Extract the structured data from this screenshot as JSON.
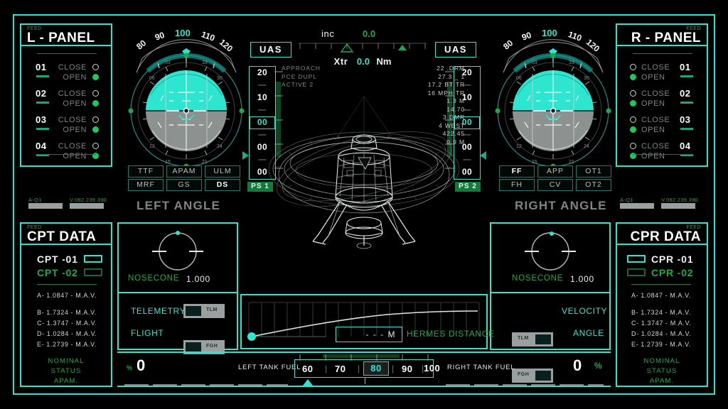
{
  "left_panel": {
    "feed": "FEED",
    "title": "L - PANEL",
    "ports": [
      {
        "num": "01",
        "close": "CLOSE",
        "open": "OPEN"
      },
      {
        "num": "02",
        "close": "CLOSE",
        "open": "OPEN"
      },
      {
        "num": "03",
        "close": "CLOSE",
        "open": "OPEN"
      },
      {
        "num": "04",
        "close": "CLOSE",
        "open": "OPEN"
      }
    ],
    "tag_a": "A-Q1",
    "tag_b": "V.092.239.390"
  },
  "right_panel": {
    "feed": "FEED",
    "title": "R - PANEL",
    "ports": [
      {
        "num": "01",
        "close": "CLOSE",
        "open": "OPEN"
      },
      {
        "num": "02",
        "close": "CLOSE",
        "open": "OPEN"
      },
      {
        "num": "03",
        "close": "CLOSE",
        "open": "OPEN"
      },
      {
        "num": "04",
        "close": "CLOSE",
        "open": "OPEN"
      }
    ],
    "tag_a": "A-Q1",
    "tag_b": "V.092.239.390"
  },
  "header": {
    "inc_label": "inc",
    "inc_value": "0.0",
    "xtr_label": "Xtr",
    "xtr_value": "0.0",
    "xtr_unit": "Nm",
    "uas_left": "UAS",
    "uas_right": "UAS"
  },
  "attitude_left": {
    "heading_ticks": [
      "80",
      "90",
      "100",
      "110",
      "120"
    ],
    "heading_selected": "100",
    "compass_ticks": [
      "03",
      "33",
      "06",
      "30",
      "12",
      "24",
      "15",
      "21"
    ],
    "angle_label": "LEFT ANGLE"
  },
  "attitude_right": {
    "heading_ticks": [
      "80",
      "90",
      "100",
      "110",
      "120"
    ],
    "heading_selected": "100",
    "compass_ticks": [
      "03",
      "33",
      "06",
      "30",
      "12",
      "24",
      "15",
      "21"
    ],
    "angle_label": "RIGHT ANGLE"
  },
  "buttons_left": [
    "TTF",
    "APAM",
    "ULM",
    "MRF",
    "GS",
    "DS"
  ],
  "buttons_left_active": "DS",
  "buttons_right": [
    "FF",
    "APP",
    "OT1",
    "FH",
    "CV",
    "OT2"
  ],
  "buttons_right_active": "FF",
  "tape_left": {
    "cells": [
      "20",
      "—",
      "10",
      "—",
      "00",
      "—",
      "00",
      "—",
      "00"
    ],
    "selected_index": 4,
    "ps_label": "PS 1"
  },
  "tape_right": {
    "cells": [
      "20",
      "—",
      "10",
      "—",
      "00",
      "—",
      "00",
      "—",
      "00"
    ],
    "selected_index": 4,
    "ps_label": "PS 2"
  },
  "status_left_lines": [
    "APPROACH",
    "PCE DUPL",
    "ACTIVE 2"
  ],
  "status_right_lines": [
    "22 .DRM",
    "27.3 _ 1",
    "17.2  BT  TR",
    "16 MPH   TR",
    "1.3 M",
    "14.70",
    "3 DMR",
    "4 WEST",
    "422.45",
    "0.9 M"
  ],
  "cpt_data": {
    "feed": "FEED",
    "title": "CPT DATA",
    "rows": [
      {
        "label": "CPT -01",
        "active": true
      },
      {
        "label": "CPT -02",
        "active": false
      }
    ],
    "readouts": [
      "A- 1.0847  -  M.A.V.",
      "B- 1.7324  -  M.A.V.",
      "C- 1.3747  -  M.A.V.",
      "D- 1.0284  -  M.A.V.",
      "E- 1.2739  -  M.A.V."
    ],
    "status": [
      "NOMINAL",
      "STATUS",
      "APAM."
    ]
  },
  "cpr_data": {
    "feed": "FEED",
    "title": "CPR DATA",
    "rows": [
      {
        "label": "CPR -01",
        "active": true
      },
      {
        "label": "CPR -02",
        "active": false
      }
    ],
    "readouts": [
      "A- 1.0847  -  M.A.V.",
      "B- 1.7324  -  M.A.V.",
      "C- 1.3747  -  M.A.V.",
      "D- 1.0284  -  M.A.V.",
      "E- 1.2739  -  M.A.V."
    ],
    "status": [
      "NOMINAL",
      "STATUS",
      "APAM."
    ]
  },
  "nosecone_left": {
    "label": "NOSECONE",
    "value": "1.000"
  },
  "nosecone_right": {
    "label": "NOSECONE",
    "value": "1.000"
  },
  "toggles_left": [
    {
      "label": "TELEMETRY",
      "tag": "TLM"
    },
    {
      "label": "FLIGHT",
      "tag": "FGH"
    }
  ],
  "toggles_right": [
    {
      "label": "VELOCITY",
      "tag": "TLM"
    },
    {
      "label": "ANGLE",
      "tag": "FGH"
    }
  ],
  "hermes": {
    "label": "HERMES DISTANCE",
    "value": "- - -  M"
  },
  "fuel": {
    "left_label": "LEFT TANK FUEL",
    "right_label": "RIGHT TANK FUEL",
    "left_value": "0",
    "right_value": "0",
    "left_unit": "%",
    "right_unit": "%",
    "scale": [
      "60",
      "70",
      "80",
      "90",
      "100"
    ],
    "scale_selected": "80"
  },
  "colors": {
    "accent": "#2ee6cf",
    "green": "#1ea94f",
    "grey": "#9aa0a0",
    "white": "#ffffff"
  }
}
